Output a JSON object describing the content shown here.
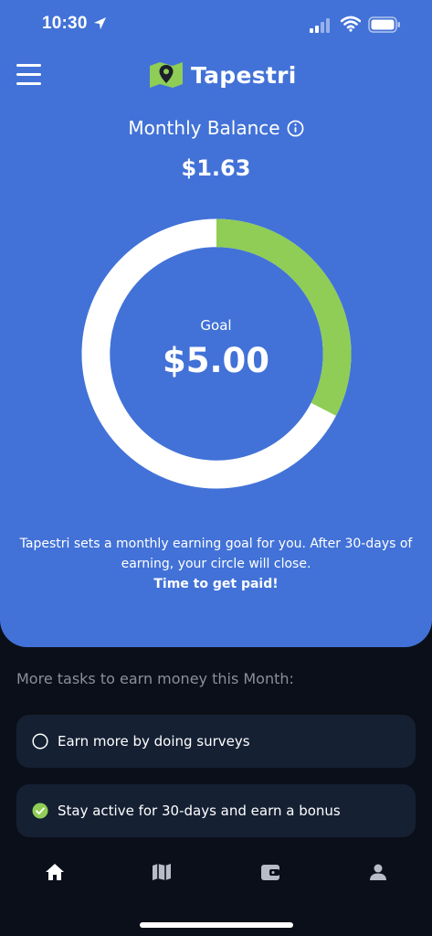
{
  "status_bar": {
    "time": "10:30"
  },
  "header": {
    "app_name": "Tapestri"
  },
  "balance": {
    "title": "Monthly Balance",
    "amount": "$1.63"
  },
  "goal": {
    "label": "Goal",
    "amount": "$5.00",
    "progress_fraction": 0.326
  },
  "description": {
    "text": "Tapestri sets a monthly earning goal for you. After 30-days of earning, your circle will close.",
    "emphasis": "Time to get paid!"
  },
  "tasks": {
    "heading": "More tasks to earn money this Month:",
    "items": [
      {
        "label": "Earn more by doing surveys",
        "completed": false
      },
      {
        "label": "Stay active for 30-days and earn a bonus",
        "completed": true
      }
    ]
  },
  "tab_bar": {
    "items": [
      "home-icon",
      "map-icon",
      "wallet-icon",
      "profile-icon"
    ]
  },
  "colors": {
    "primary_blue": "#4272d7",
    "progress_green": "#8fcd56",
    "ring_track": "#ffffff",
    "background_dark": "#0b0f19",
    "card_bg": "#152033"
  }
}
